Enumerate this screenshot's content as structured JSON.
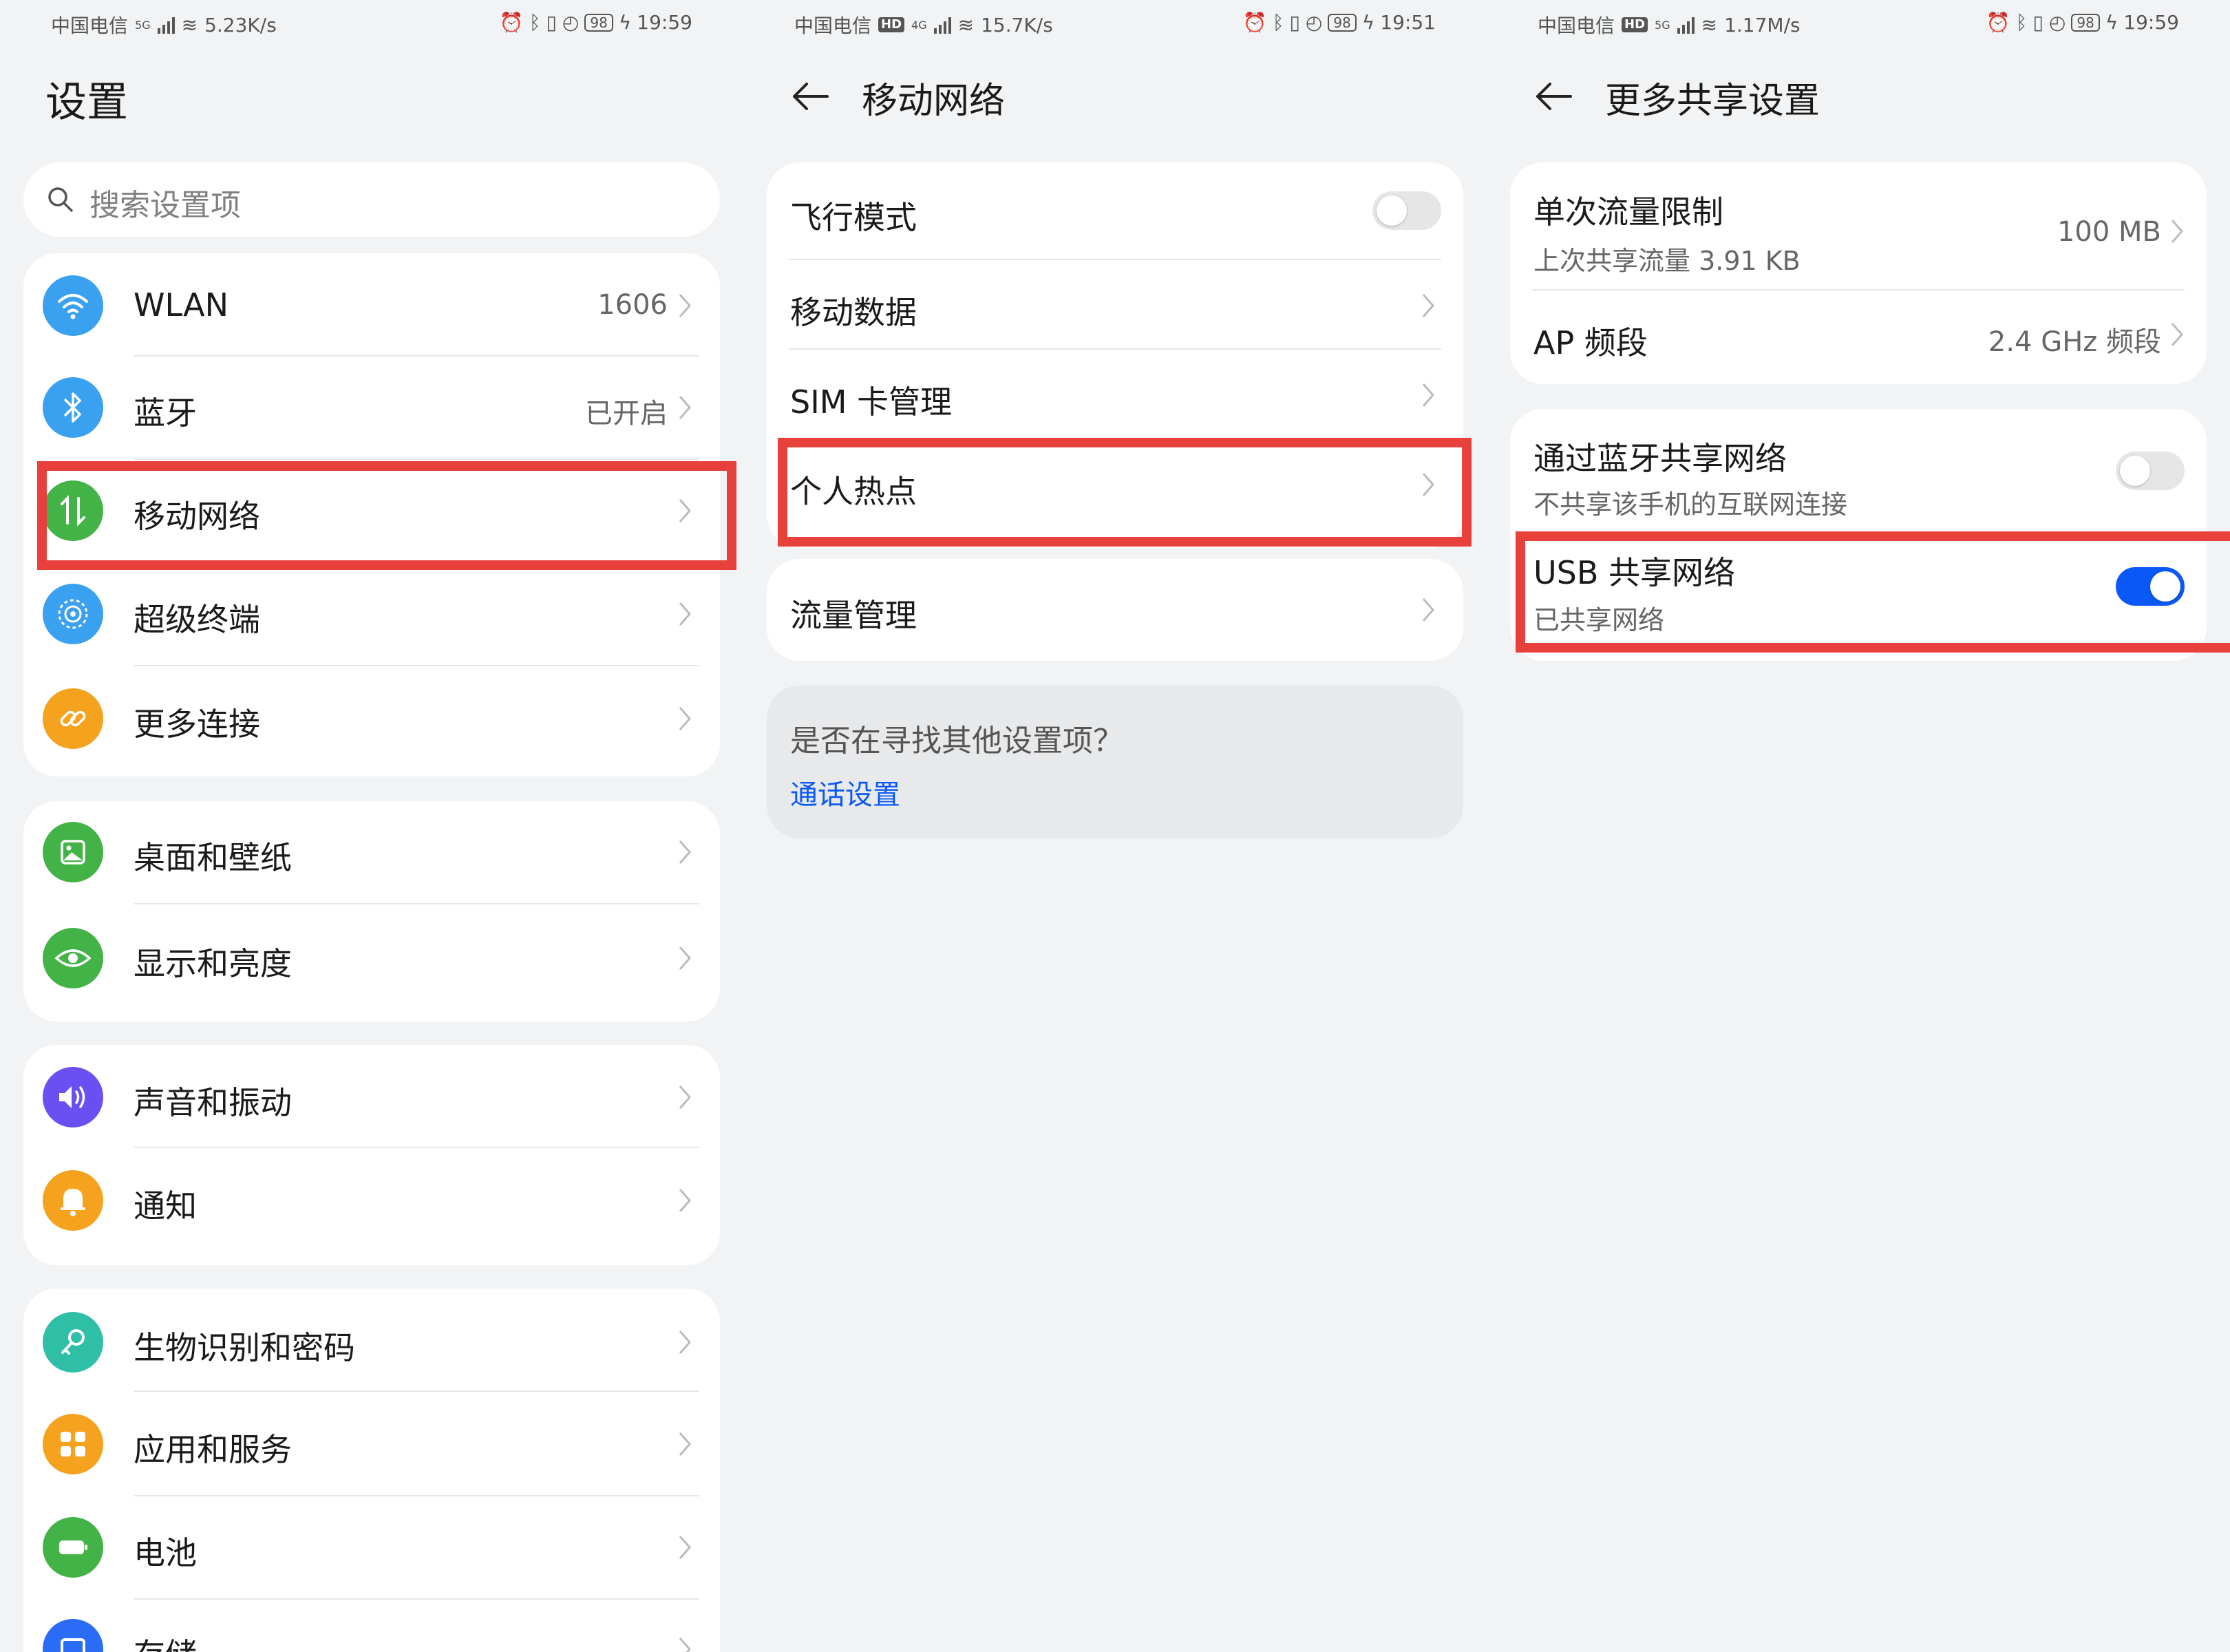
{
  "colors": {
    "accent": "#0a59f7",
    "highlight": "#e8403a",
    "background": "#f1f3f5"
  },
  "panels": [
    {
      "status": {
        "carrier": "中国电信",
        "net": "5G",
        "speed": "5.23K/s",
        "battery": "98",
        "time": "19:59"
      },
      "title": "设置",
      "search_placeholder": "搜索设置项",
      "groups": [
        {
          "items": [
            {
              "label": "WLAN",
              "value": "1606",
              "icon": "wifi-icon",
              "color": "#3aa0f0"
            },
            {
              "label": "蓝牙",
              "value": "已开启",
              "icon": "bluetooth-icon",
              "color": "#3aa0f0"
            },
            {
              "label": "移动网络",
              "value": "",
              "icon": "mobile-network-icon",
              "color": "#43b348"
            },
            {
              "label": "超级终端",
              "value": "",
              "icon": "super-device-icon",
              "color": "#3aa0f0"
            },
            {
              "label": "更多连接",
              "value": "",
              "icon": "link-icon",
              "color": "#f5a21f"
            }
          ]
        },
        {
          "items": [
            {
              "label": "桌面和壁纸",
              "value": "",
              "icon": "wallpaper-icon",
              "color": "#43b348"
            },
            {
              "label": "显示和亮度",
              "value": "",
              "icon": "eye-icon",
              "color": "#43b348"
            }
          ]
        },
        {
          "items": [
            {
              "label": "声音和振动",
              "value": "",
              "icon": "sound-icon",
              "color": "#6a4ff2"
            },
            {
              "label": "通知",
              "value": "",
              "icon": "bell-icon",
              "color": "#f5a21f"
            }
          ]
        },
        {
          "items": [
            {
              "label": "生物识别和密码",
              "value": "",
              "icon": "key-icon",
              "color": "#2fbfa6"
            },
            {
              "label": "应用和服务",
              "value": "",
              "icon": "apps-icon",
              "color": "#f5a21f"
            },
            {
              "label": "电池",
              "value": "",
              "icon": "battery-icon",
              "color": "#43b348"
            },
            {
              "label": "存储",
              "value": "",
              "icon": "storage-icon",
              "color": "#2a6cf5"
            }
          ]
        }
      ]
    },
    {
      "status": {
        "carrier": "中国电信",
        "hd": "HD",
        "net": "4G",
        "speed": "15.7K/s",
        "battery": "98",
        "time": "19:51"
      },
      "title": "移动网络",
      "rows": [
        {
          "label": "飞行模式",
          "type": "toggle",
          "on": false
        },
        {
          "label": "移动数据",
          "type": "link"
        },
        {
          "label": "SIM 卡管理",
          "type": "link"
        },
        {
          "label": "个人热点",
          "type": "link"
        }
      ],
      "traffic": {
        "label": "流量管理"
      },
      "hint": {
        "question": "是否在寻找其他设置项？",
        "link": "通话设置"
      }
    },
    {
      "status": {
        "carrier": "中国电信",
        "hd": "HD",
        "net": "5G",
        "speed": "1.17M/s",
        "battery": "98",
        "time": "19:59"
      },
      "title": "更多共享设置",
      "limit": {
        "label": "单次流量限制",
        "sub": "上次共享流量 3.91 KB",
        "value": "100 MB"
      },
      "band": {
        "label": "AP 频段",
        "value": "2.4 GHz 频段"
      },
      "bt_share": {
        "label": "通过蓝牙共享网络",
        "sub": "不共享该手机的互联网连接",
        "on": false
      },
      "usb_share": {
        "label": "USB 共享网络",
        "sub": "已共享网络",
        "on": true
      }
    }
  ]
}
